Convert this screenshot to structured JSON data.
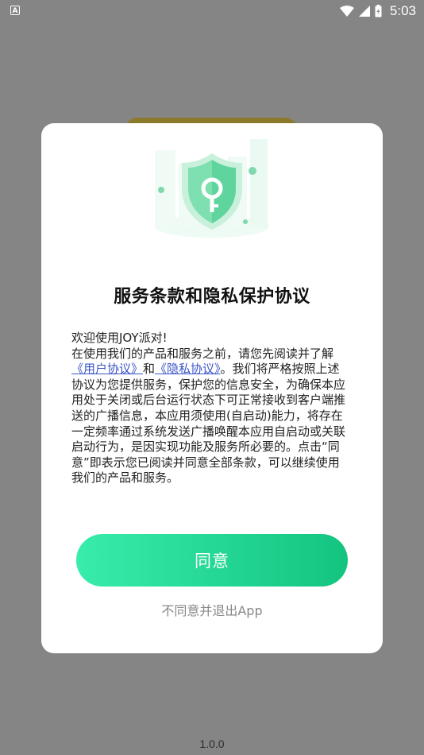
{
  "status_bar": {
    "left_icon_label": "A",
    "time": "5:03",
    "icons": [
      "wifi-icon",
      "signal-icon",
      "battery-icon"
    ]
  },
  "dialog": {
    "title": "服务条款和隐私保护协议",
    "body": {
      "greeting": "欢迎使用JOY派对!",
      "intro": "在使用我们的产品和服务之前，请您先阅读并了解",
      "user_agreement_link": "《用户协议》",
      "conjunction": "和",
      "privacy_policy_link": "《隐私协议》",
      "rest": "。我们将严格按照上述协议为您提供服务，保护您的信息安全，为确保本应用处于关闭或后台运行状态下可正常接收到客户端推送的广播信息，本应用须使用(自启动)能力，将存在一定频率通过系统发送广播唤醒本应用自启动或关联启动行为，是因实现功能及服务所必要的。点击“同意”即表示您已阅读并同意全部条款，可以继续使用我们的产品和服务。"
    },
    "agree_label": "同意",
    "disagree_label": "不同意并退出App"
  },
  "footer": {
    "version": "1.0.0"
  },
  "colors": {
    "accent_start": "#38ecab",
    "accent_end": "#12c47f",
    "link": "#3a55c8",
    "overlay": "#858585"
  }
}
